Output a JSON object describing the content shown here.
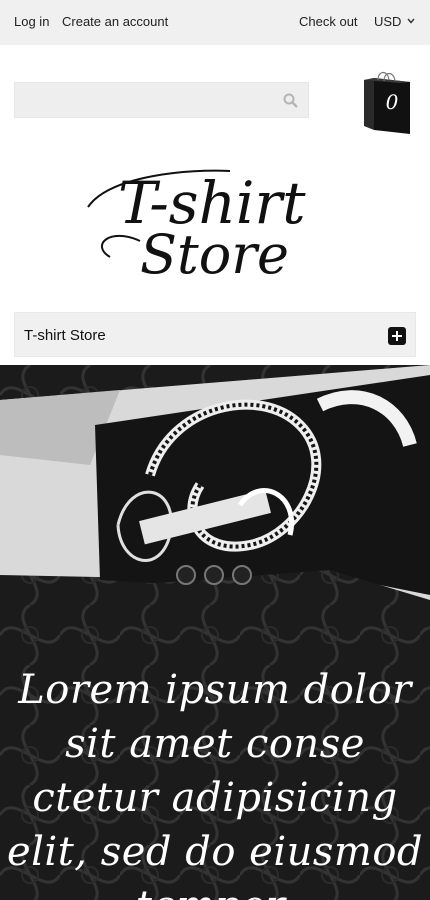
{
  "topbar": {
    "login": "Log in",
    "create_account": "Create an account",
    "checkout": "Check out",
    "currency": "USD"
  },
  "search": {
    "placeholder": "",
    "value": ""
  },
  "cart": {
    "count": "0"
  },
  "logo": {
    "line1": "T-shirt",
    "line2": "Store"
  },
  "menu": {
    "title": "T-shirt Store"
  },
  "slider": {
    "dots_count": 3
  },
  "banner": {
    "text": "Lorem ipsum dolor sit amet conse ctetur adipisicing elit, sed do eiusmod tempor."
  },
  "icons": [
    "chevron-down-icon",
    "search-icon",
    "shopping-bag-icon",
    "plus-icon"
  ],
  "colors": {
    "topbar_bg": "#f0f0f0",
    "text": "#1a1a1a",
    "banner_dark": "#1c1c1c",
    "banner_text": "#ffffff"
  }
}
